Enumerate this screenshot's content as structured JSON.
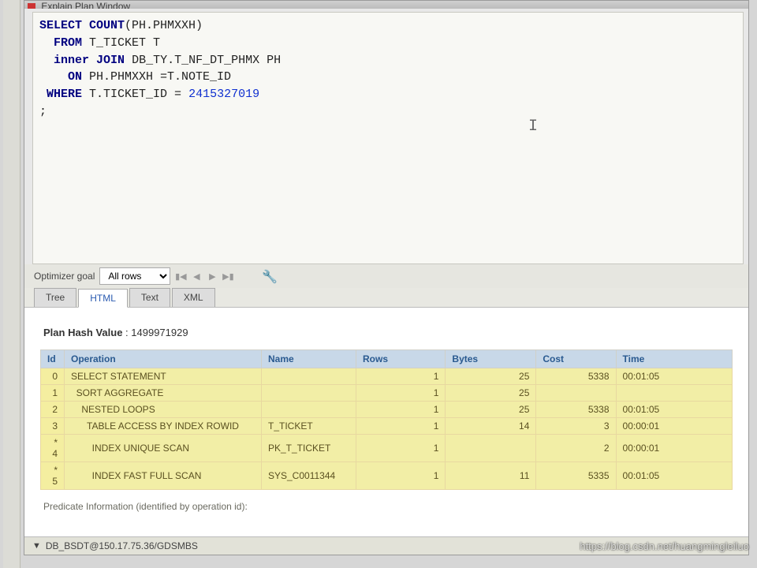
{
  "window": {
    "title": "Explain Plan Window"
  },
  "sql": {
    "l1a": "SELECT",
    "l1b": "COUNT",
    "l1c": "(PH.PHMXXH)",
    "l2a": "FROM",
    "l2b": " T_TICKET T",
    "l3a": "inner",
    "l3b": "JOIN",
    "l3c": " DB_TY.T_NF_DT_PHMX PH",
    "l4a": "ON",
    "l4b": " PH.PHMXXH =T.NOTE_ID",
    "l5a": "WHERE",
    "l5b": " T.TICKET_ID = ",
    "l5c": "2415327019",
    "l6": ";"
  },
  "toolbar": {
    "optimizer_label": "Optimizer goal",
    "optimizer_value": "All rows"
  },
  "tabs": [
    "Tree",
    "HTML",
    "Text",
    "XML"
  ],
  "plan": {
    "hash_label": "Plan Hash Value",
    "hash_value": "1499971929",
    "headers": [
      "Id",
      "Operation",
      "Name",
      "Rows",
      "Bytes",
      "Cost",
      "Time"
    ],
    "rows": [
      {
        "id": "0",
        "op": "SELECT STATEMENT",
        "name": "",
        "rows": "1",
        "bytes": "25",
        "cost": "5338",
        "time": "00:01:05"
      },
      {
        "id": "1",
        "op": "SORT AGGREGATE",
        "name": "",
        "rows": "1",
        "bytes": "25",
        "cost": "",
        "time": ""
      },
      {
        "id": "2",
        "op": "NESTED LOOPS",
        "name": "",
        "rows": "1",
        "bytes": "25",
        "cost": "5338",
        "time": "00:01:05"
      },
      {
        "id": "3",
        "op": "TABLE ACCESS BY INDEX ROWID",
        "name": "T_TICKET",
        "rows": "1",
        "bytes": "14",
        "cost": "3",
        "time": "00:00:01"
      },
      {
        "id": "* 4",
        "op": "INDEX UNIQUE SCAN",
        "name": "PK_T_TICKET",
        "rows": "1",
        "bytes": "",
        "cost": "2",
        "time": "00:00:01"
      },
      {
        "id": "* 5",
        "op": "INDEX FAST FULL SCAN",
        "name": "SYS_C0011344",
        "rows": "1",
        "bytes": "11",
        "cost": "5335",
        "time": "00:01:05"
      }
    ],
    "indents": [
      0,
      1,
      2,
      3,
      4,
      4
    ],
    "predicate_label": "Predicate Information (identified by operation id):"
  },
  "status": {
    "text": "DB_BSDT@150.17.75.36/GDSMBS"
  },
  "watermark": "https://blog.csdn.net/huangmingleiluo"
}
